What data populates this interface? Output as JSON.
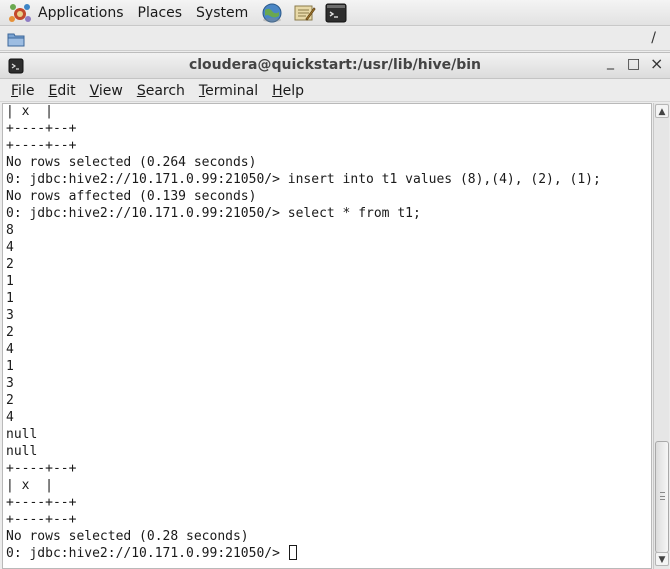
{
  "panel": {
    "menus": [
      "Applications",
      "Places",
      "System"
    ],
    "launchers": [
      "globe-icon",
      "edit-icon",
      "terminal-icon"
    ]
  },
  "file_strip": {
    "path": "/"
  },
  "window": {
    "title": "cloudera@quickstart:/usr/lib/hive/bin",
    "minimize": "_",
    "maximize": "□",
    "close": "×"
  },
  "menubar": {
    "items": [
      {
        "accel": "F",
        "rest": "ile"
      },
      {
        "accel": "E",
        "rest": "dit"
      },
      {
        "accel": "V",
        "rest": "iew"
      },
      {
        "accel": "S",
        "rest": "earch"
      },
      {
        "accel": "T",
        "rest": "erminal"
      },
      {
        "accel": "H",
        "rest": "elp"
      }
    ]
  },
  "terminal": {
    "lines": [
      "| x  |",
      "+----+--+",
      "+----+--+",
      "No rows selected (0.264 seconds)",
      "0: jdbc:hive2://10.171.0.99:21050/> insert into t1 values (8),(4), (2), (1);",
      "No rows affected (0.139 seconds)",
      "0: jdbc:hive2://10.171.0.99:21050/> select * from t1;",
      "8",
      "4",
      "2",
      "1",
      "1",
      "3",
      "2",
      "4",
      "1",
      "3",
      "2",
      "4",
      "null",
      "null",
      "+----+--+",
      "| x  |",
      "+----+--+",
      "+----+--+",
      "No rows selected (0.28 seconds)"
    ],
    "prompt": "0: jdbc:hive2://10.171.0.99:21050/> "
  }
}
